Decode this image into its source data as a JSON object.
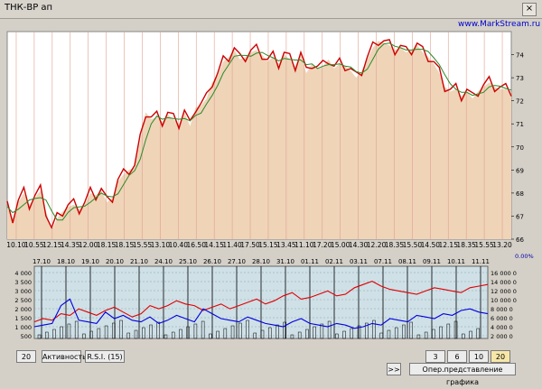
{
  "window": {
    "title": "ТНК-ВР ап",
    "watermark": "www.MarkStream.ru",
    "close_glyph": "×"
  },
  "colors": {
    "price_fill": "#efd4b8",
    "price_line": "#cc0000",
    "ma_line": "#2a8a2a",
    "lower_bg": "#cfe0e7",
    "red_series": "#e00000",
    "blue_series": "#0000dd"
  },
  "chart_data": [
    {
      "type": "line",
      "title": "ТНК-ВР ап",
      "ylim": [
        66,
        75
      ],
      "y_ticks": [
        "74",
        "73",
        "72",
        "71",
        "70",
        "69",
        "68",
        "67",
        "66"
      ],
      "x_ticks": [
        "10.10",
        "10.55",
        "12.15",
        "14.35",
        "12.00",
        "18.15",
        "18.15",
        "15.55",
        "13.10",
        "10.40",
        "16.50",
        "14.15",
        "11.40",
        "17.50",
        "15.15",
        "13.45",
        "11.10",
        "17.20",
        "15.00",
        "14.30",
        "12.20",
        "18.35",
        "15.50",
        "14.50",
        "12.15",
        "18.35",
        "15.55",
        "13.20"
      ],
      "series": [
        {
          "values": [
            67.4,
            66.9,
            67.6,
            68.0,
            67.5,
            67.8,
            68.1,
            67.2,
            66.4,
            66.9,
            67.2,
            67.4,
            67.5,
            67.3,
            67.5,
            68.0,
            67.9,
            68.1,
            67.6,
            67.8,
            68.5,
            68.8,
            69.0,
            69.1,
            70.3,
            71.5,
            71.2,
            71.3,
            71.1,
            71.4,
            71.2,
            71.0,
            71.5,
            70.9,
            71.7,
            71.8,
            72.1,
            72.8,
            73.1,
            73.7,
            73.9,
            74.2,
            73.8,
            73.9,
            74.1,
            74.2,
            74.0,
            73.7,
            73.9,
            73.6,
            74.0,
            73.8,
            73.5,
            74.0,
            73.2,
            73.6,
            73.4,
            73.5,
            73.8,
            73.4,
            73.6,
            73.5,
            73.3,
            73.0,
            73.3,
            73.8,
            74.3,
            74.6,
            74.5,
            74.4,
            74.2,
            74.3,
            74.1,
            74.2,
            74.4,
            74.1,
            73.9,
            73.6,
            73.2,
            72.6,
            72.4,
            72.5,
            72.2,
            72.4,
            72.1,
            72.4,
            72.6,
            72.8,
            72.6,
            72.5,
            72.5,
            72.4
          ]
        }
      ]
    },
    {
      "type": "line",
      "title": "R.S.I. (15)",
      "y_ticks_left": [
        "4 000",
        "3 500",
        "3 000",
        "2 500",
        "2 000",
        "1 500",
        "1 000",
        "500"
      ],
      "y_ticks_right": [
        "16 000 0",
        "14 000 0",
        "12 000 0",
        "10 000 0",
        "8 000 0",
        "6 000 0",
        "4 000 0",
        "2 000 0"
      ],
      "x_ticks": [
        "17.10",
        "18.10",
        "19.10",
        "20.10",
        "21.10",
        "24.10",
        "25.10",
        "26.10",
        "27.10",
        "28.10",
        "31.10",
        "01.11",
        "02.11",
        "03.11",
        "07.11",
        "08.11",
        "09.11",
        "10.11",
        "11.11"
      ],
      "pct_label": "0.00%",
      "series": [
        {
          "name": "red",
          "values": [
            8,
            10,
            9,
            13,
            12,
            16,
            14,
            12,
            15,
            17,
            14,
            11,
            13,
            18,
            16,
            18,
            21,
            19,
            18,
            15,
            17,
            19,
            16,
            18,
            20,
            22,
            19,
            21,
            24,
            26,
            22,
            23,
            25,
            27,
            24,
            25,
            29,
            31,
            33,
            30,
            28,
            27,
            26,
            25,
            27,
            29,
            28,
            27,
            26,
            29,
            30,
            31
          ]
        },
        {
          "name": "blue",
          "values": [
            5,
            6,
            7,
            18,
            22,
            9,
            8,
            7,
            14,
            10,
            12,
            9,
            8,
            11,
            7,
            9,
            12,
            10,
            8,
            16,
            13,
            10,
            9,
            8,
            11,
            9,
            7,
            6,
            5,
            8,
            10,
            7,
            6,
            5,
            7,
            6,
            4,
            5,
            7,
            6,
            10,
            9,
            8,
            12,
            11,
            10,
            13,
            12,
            15,
            16,
            14,
            13
          ]
        }
      ]
    }
  ],
  "controls": {
    "period_value": "20",
    "activity_label": "Активность",
    "rsi_label": "R.S.I.  (15)",
    "range_3": "3 дн.",
    "range_6": "6 дн.",
    "range_10": "10 дн.",
    "range_20": "20 дн.",
    "scroll_label": ">>",
    "view_label": "Опер.представление графика"
  }
}
